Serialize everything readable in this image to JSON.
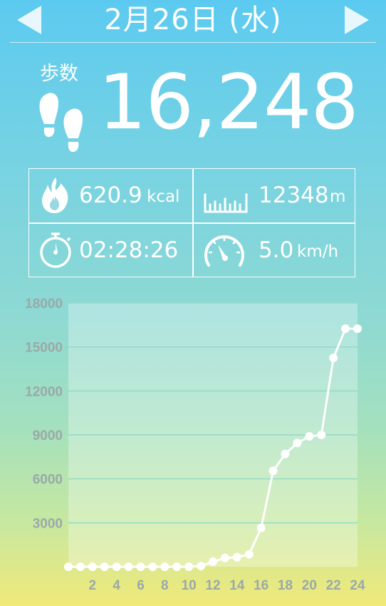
{
  "header": {
    "date_title": "2月26日 (水)"
  },
  "steps": {
    "label": "歩数",
    "value": "16,248"
  },
  "stats": {
    "calories": {
      "value": "620.9",
      "unit": "kcal"
    },
    "distance": {
      "value": "12348",
      "unit": "m"
    },
    "duration": {
      "value": "02:28:26",
      "unit": ""
    },
    "speed": {
      "value": "5.0",
      "unit": "km/h"
    }
  },
  "icons": {
    "prev": "triangle-left-icon",
    "next": "triangle-right-icon",
    "steps": "footprints-icon",
    "calories": "flame-icon",
    "distance": "ruler-icon",
    "duration": "stopwatch-icon",
    "speed": "speedometer-icon"
  },
  "colors": {
    "text": "#ffffff",
    "gradient_top": "#5ccaf0",
    "gradient_bottom": "#f1e979",
    "axis_label": "#9aa9a8",
    "grid": "#93dcc7"
  },
  "chart_data": {
    "type": "line",
    "title": "",
    "xlabel": "",
    "ylabel": "",
    "x": [
      0,
      1,
      2,
      3,
      4,
      5,
      6,
      7,
      8,
      9,
      10,
      11,
      12,
      13,
      14,
      15,
      16,
      17,
      18,
      19,
      20,
      21,
      22,
      23,
      24
    ],
    "x_tick_labels": [
      "2",
      "4",
      "6",
      "8",
      "10",
      "12",
      "14",
      "16",
      "18",
      "20",
      "22",
      "24"
    ],
    "x_ticks": [
      2,
      4,
      6,
      8,
      10,
      12,
      14,
      16,
      18,
      20,
      22,
      24
    ],
    "y_tick_labels": [
      "3000",
      "6000",
      "9000",
      "12000",
      "15000",
      "18000"
    ],
    "y_ticks": [
      3000,
      6000,
      9000,
      12000,
      15000,
      18000
    ],
    "ylim": [
      0,
      18000
    ],
    "xlim": [
      0,
      24
    ],
    "grid": true,
    "series": [
      {
        "values": [
          0,
          0,
          0,
          0,
          0,
          0,
          0,
          0,
          0,
          0,
          0,
          50,
          350,
          600,
          650,
          850,
          2650,
          6550,
          7700,
          8450,
          8900,
          9000,
          14250,
          16248,
          16248
        ]
      }
    ]
  }
}
